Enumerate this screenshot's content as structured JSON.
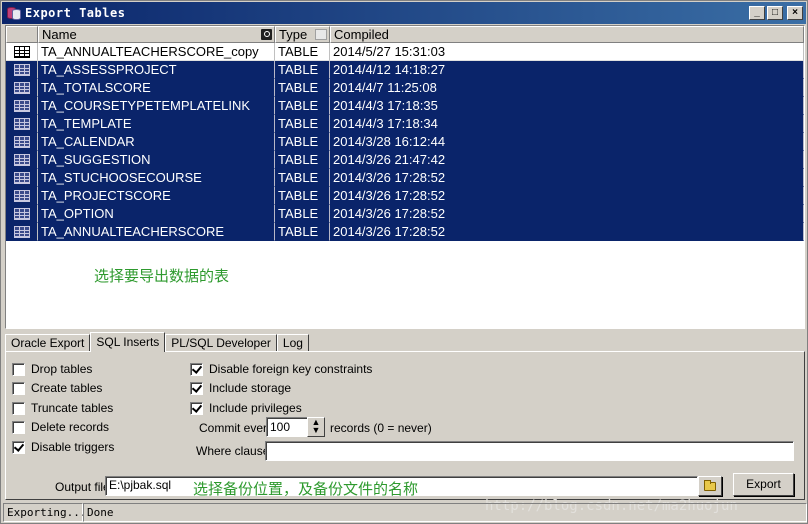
{
  "window": {
    "title": "Export Tables",
    "buttons": {
      "minimize": "_",
      "maximize": "□",
      "close": "×"
    }
  },
  "grid": {
    "columns": [
      "Name",
      "Type",
      "Compiled"
    ],
    "rows": [
      {
        "name": "TA_ANNUALTEACHERSCORE_copy",
        "type": "TABLE",
        "compiled": "2014/5/27 15:31:03",
        "selected": false
      },
      {
        "name": "TA_ASSESSPROJECT",
        "type": "TABLE",
        "compiled": "2014/4/12 14:18:27",
        "selected": true
      },
      {
        "name": "TA_TOTALSCORE",
        "type": "TABLE",
        "compiled": "2014/4/7 11:25:08",
        "selected": true
      },
      {
        "name": "TA_COURSETYPETEMPLATELINK",
        "type": "TABLE",
        "compiled": "2014/4/3 17:18:35",
        "selected": true
      },
      {
        "name": "TA_TEMPLATE",
        "type": "TABLE",
        "compiled": "2014/4/3 17:18:34",
        "selected": true
      },
      {
        "name": "TA_CALENDAR",
        "type": "TABLE",
        "compiled": "2014/3/28 16:12:44",
        "selected": true
      },
      {
        "name": "TA_SUGGESTION",
        "type": "TABLE",
        "compiled": "2014/3/26 21:47:42",
        "selected": true
      },
      {
        "name": "TA_STUCHOOSECOURSE",
        "type": "TABLE",
        "compiled": "2014/3/26 17:28:52",
        "selected": true
      },
      {
        "name": "TA_PROJECTSCORE",
        "type": "TABLE",
        "compiled": "2014/3/26 17:28:52",
        "selected": true
      },
      {
        "name": "TA_OPTION",
        "type": "TABLE",
        "compiled": "2014/3/26 17:28:52",
        "selected": true
      },
      {
        "name": "TA_ANNUALTEACHERSCORE",
        "type": "TABLE",
        "compiled": "2014/3/26 17:28:52",
        "selected": true
      }
    ],
    "annotation": "选择要导出数据的表"
  },
  "tabs": [
    {
      "label": "Oracle Export",
      "active": false
    },
    {
      "label": "SQL Inserts",
      "active": true
    },
    {
      "label": "PL/SQL Developer",
      "active": false
    },
    {
      "label": "Log",
      "active": false
    }
  ],
  "options_left": [
    {
      "label": "Drop tables",
      "checked": false
    },
    {
      "label": "Create tables",
      "checked": false
    },
    {
      "label": "Truncate tables",
      "checked": false
    },
    {
      "label": "Delete records",
      "checked": false
    },
    {
      "label": "Disable triggers",
      "checked": true
    }
  ],
  "options_right": [
    {
      "label": "Disable foreign key constraints",
      "checked": true
    },
    {
      "label": "Include storage",
      "checked": true
    },
    {
      "label": "Include privileges",
      "checked": true
    }
  ],
  "commit": {
    "label": "Commit every",
    "value": "100",
    "suffix": "records (0 = never)"
  },
  "where": {
    "label": "Where clause",
    "value": ""
  },
  "output": {
    "label": "Output file",
    "value": "E:\\pjbak.sql",
    "annotation": "选择备份位置，及备份文件的名称"
  },
  "export_button": "Export",
  "status": {
    "left": "Exporting...",
    "right": "Done"
  },
  "watermark": "http://blog.csdn.net/ma2huojun",
  "colors": {
    "selection": "#0a246a",
    "annotation": "#2e9a2e",
    "face": "#d4d0c8"
  }
}
